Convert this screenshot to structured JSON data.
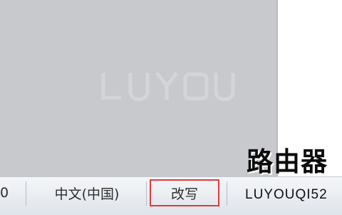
{
  "statusbar": {
    "page_count": "0",
    "language": "中文(中国)",
    "insert_mode": "改写"
  },
  "logo": {
    "chinese": "路由器",
    "latin": "LUYOUQI52"
  }
}
